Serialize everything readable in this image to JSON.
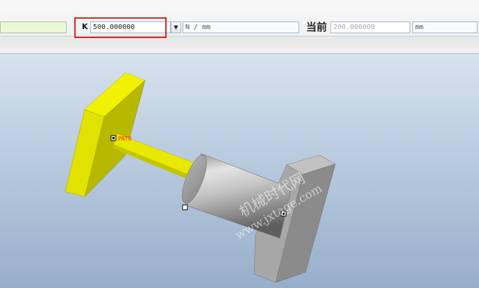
{
  "toolbar": {
    "k_label": "K",
    "k_value": "500.000000",
    "k_dropdown_arrow": "▼",
    "k_unit": "N / mm",
    "current_label": "当前",
    "current_value": "200.000000",
    "current_unit": "mm"
  },
  "viewport": {
    "point_label": "PNT0",
    "watermark_cn": "机械时代网",
    "watermark_url": "www.jxtage.com"
  },
  "colors": {
    "highlight": "#e02020",
    "yellow_part": "#e6e600",
    "gray_part": "#a9a9a9"
  }
}
